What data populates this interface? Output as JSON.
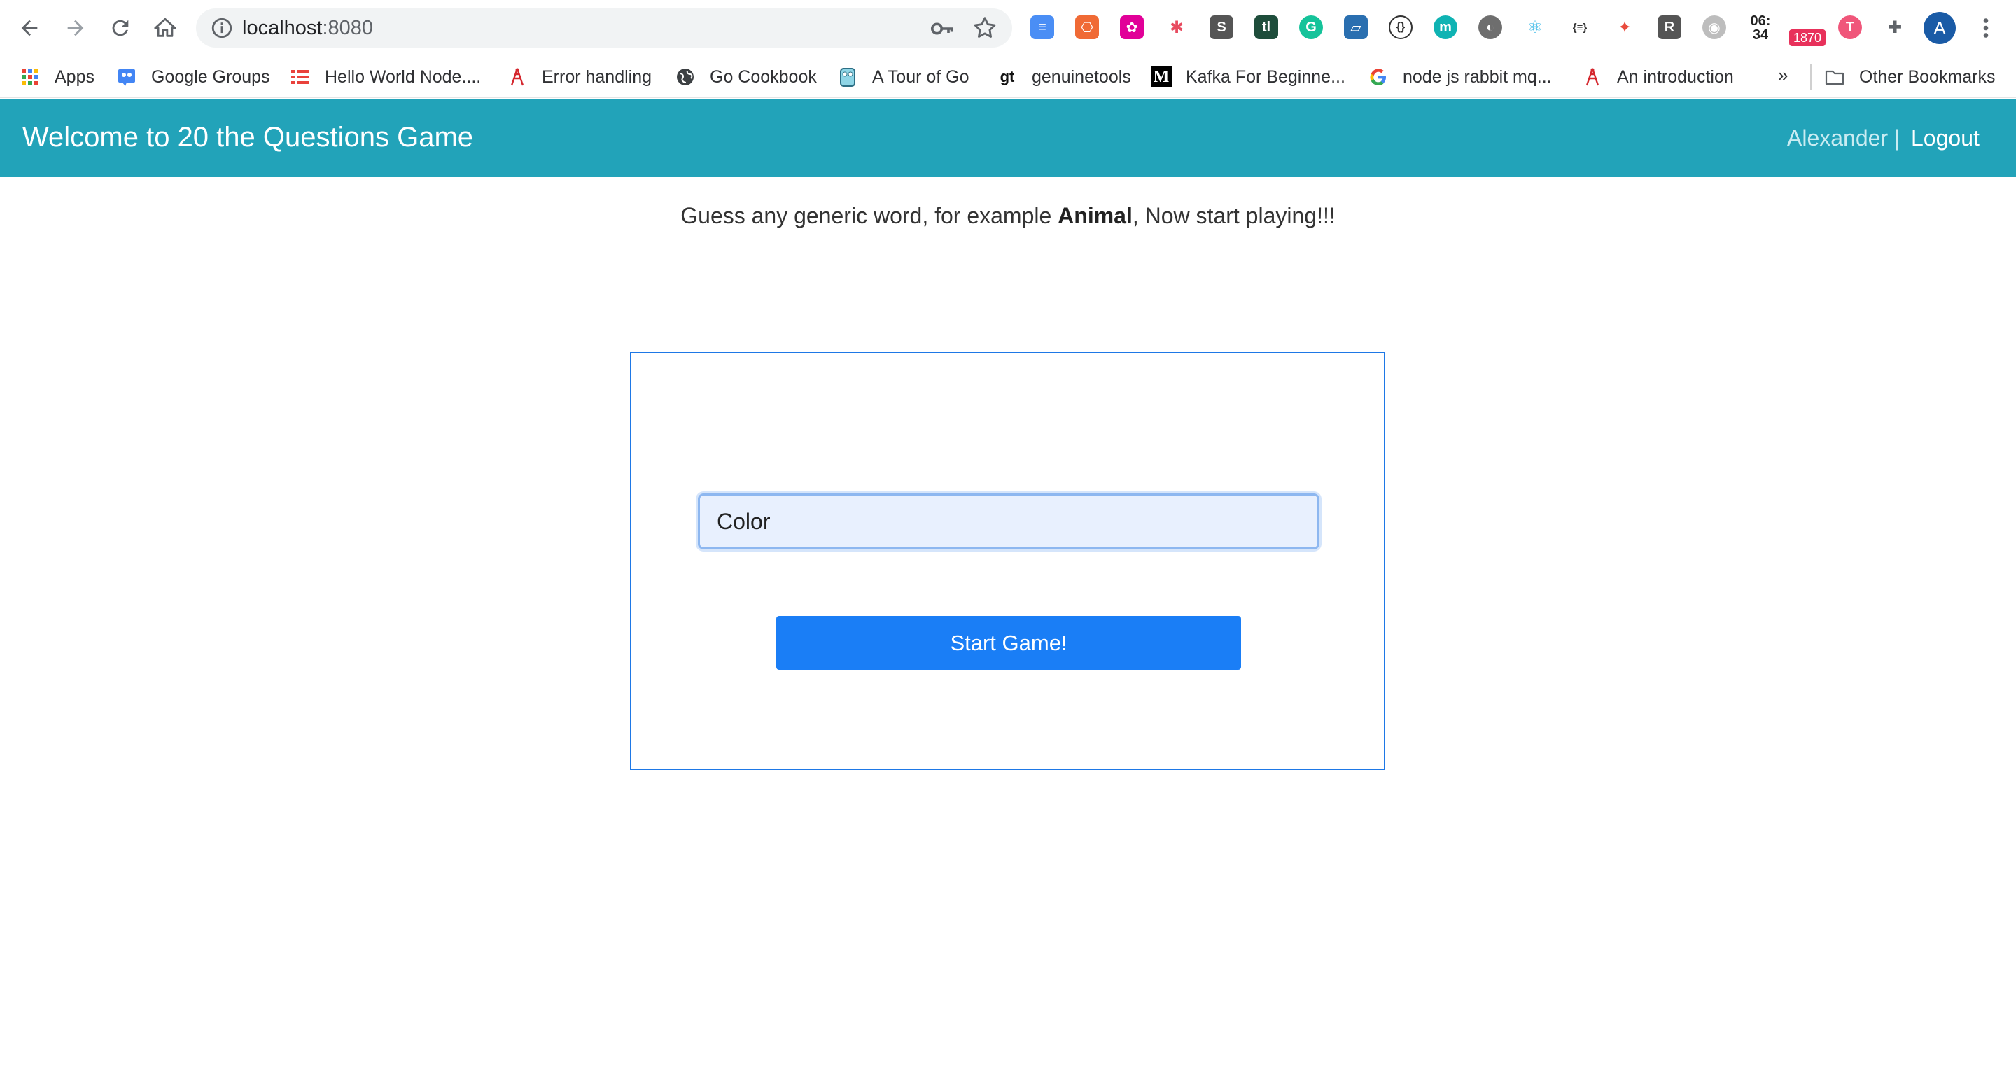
{
  "browser": {
    "url_host": "localhost",
    "url_port": ":8080",
    "clock_text": "06:\n34",
    "badge_count": "1870",
    "avatar_letter": "A",
    "extensions": [
      {
        "icon": "layers-icon",
        "color": "#4a8ef5",
        "glyph": "≡"
      },
      {
        "icon": "sitemap-icon",
        "color": "#f06a35",
        "glyph": "⎔"
      },
      {
        "icon": "graphql-icon",
        "color": "#e10098",
        "glyph": "✿"
      },
      {
        "icon": "pinwheel-icon",
        "color": "#e84a5f",
        "glyph": "✱"
      },
      {
        "icon": "s-icon",
        "color": "#555555",
        "glyph": "S"
      },
      {
        "icon": "tldr-icon",
        "color": "#1e4d3b",
        "glyph": "tl"
      },
      {
        "icon": "grammarly-icon",
        "color": "#15c39a",
        "glyph": "G"
      },
      {
        "icon": "book-icon",
        "color": "#2a6fb0",
        "glyph": "▱"
      },
      {
        "icon": "braces-circle-icon",
        "color": "#333333",
        "glyph": "{}"
      },
      {
        "icon": "m-circle-icon",
        "color": "#0fb3b3",
        "glyph": "m"
      },
      {
        "icon": "moon-icon",
        "color": "#6e6e6e",
        "glyph": "◐"
      },
      {
        "icon": "react-icon",
        "color": "#2fb5e6",
        "glyph": "⚛"
      },
      {
        "icon": "json-icon",
        "color": "#333333",
        "glyph": "{≡}"
      },
      {
        "icon": "color-wheel-icon",
        "color": "#e94b3c",
        "glyph": "✦"
      },
      {
        "icon": "r-icon",
        "color": "#555555",
        "glyph": "R"
      },
      {
        "icon": "panda-icon",
        "color": "#bdbdbd",
        "glyph": "◉"
      },
      {
        "icon": "tomato-icon",
        "color": "#f0567a",
        "glyph": "T"
      },
      {
        "icon": "puzzle-icon",
        "color": "#5f6368",
        "glyph": "✚"
      }
    ],
    "colors": {
      "accent": "#22a3b9",
      "button": "#1a7ef6",
      "box_border": "#1e78e6"
    }
  },
  "bookmarks": {
    "items": [
      {
        "label": "Apps",
        "icon": "apps-grid-icon"
      },
      {
        "label": "Google Groups",
        "icon": "google-groups-icon"
      },
      {
        "label": "Hello World Node....",
        "icon": "list-icon"
      },
      {
        "label": "Error handling",
        "icon": "tower-icon"
      },
      {
        "label": "Go Cookbook",
        "icon": "globe-icon"
      },
      {
        "label": "A Tour of Go",
        "icon": "gopher-icon"
      },
      {
        "label": "genuinetools",
        "icon": "gt-icon"
      },
      {
        "label": "Kafka For Beginne...",
        "icon": "medium-icon"
      },
      {
        "label": "node js rabbit mq...",
        "icon": "google-icon"
      },
      {
        "label": "An introduction",
        "icon": "tower-icon"
      }
    ],
    "more": "»",
    "other": "Other Bookmarks"
  },
  "header": {
    "title": "Welcome to 20 the Questions Game",
    "user": "Alexander |",
    "logout": "Logout"
  },
  "main": {
    "intro_before": "Guess any generic word, for example ",
    "intro_bold": "Animal",
    "intro_after": ", Now start playing!!!",
    "input_value": "Color",
    "start_button": "Start Game!"
  }
}
